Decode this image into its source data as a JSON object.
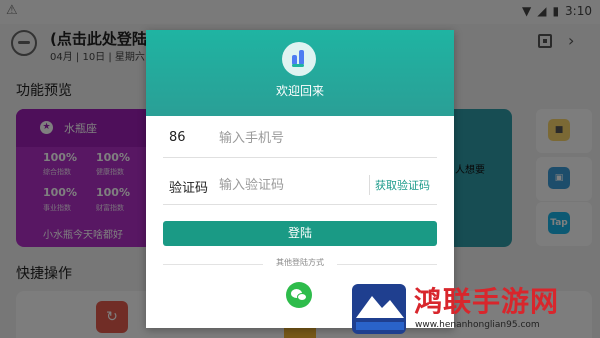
{
  "status_bar": {
    "time": "3:10"
  },
  "app_bar": {
    "user_title": "(点击此处登陆账",
    "date": "04月 | 10日 | 星期六"
  },
  "sections": {
    "preview": "功能预览",
    "quick": "快捷操作"
  },
  "zodiac_card": {
    "name": "水瓶座",
    "stats": [
      {
        "value": "100%",
        "label": "综合指数"
      },
      {
        "value": "100%",
        "label": "健康指数"
      },
      {
        "value": "100%",
        "label": "事业指数"
      },
      {
        "value": "100%",
        "label": "财富指数"
      }
    ],
    "message": "小水瓶今天啥都好"
  },
  "teal_card_text": "人想要",
  "side_cards": [
    {
      "icon": "cube-icon"
    },
    {
      "icon": "image-icon"
    },
    {
      "icon": "tap-icon",
      "label": "Tap"
    }
  ],
  "login_dialog": {
    "welcome": "欢迎回来",
    "phone": {
      "prefix": "86",
      "placeholder": "输入手机号"
    },
    "code": {
      "label": "验证码",
      "placeholder": "输入验证码",
      "get_code": "获取验证码"
    },
    "login_button": "登陆",
    "other_methods": "其他登陆方式",
    "wechat_icon": "wechat-icon"
  },
  "watermark": {
    "title": "鸿联手游网",
    "url": "www.henanhonglian95.com"
  }
}
